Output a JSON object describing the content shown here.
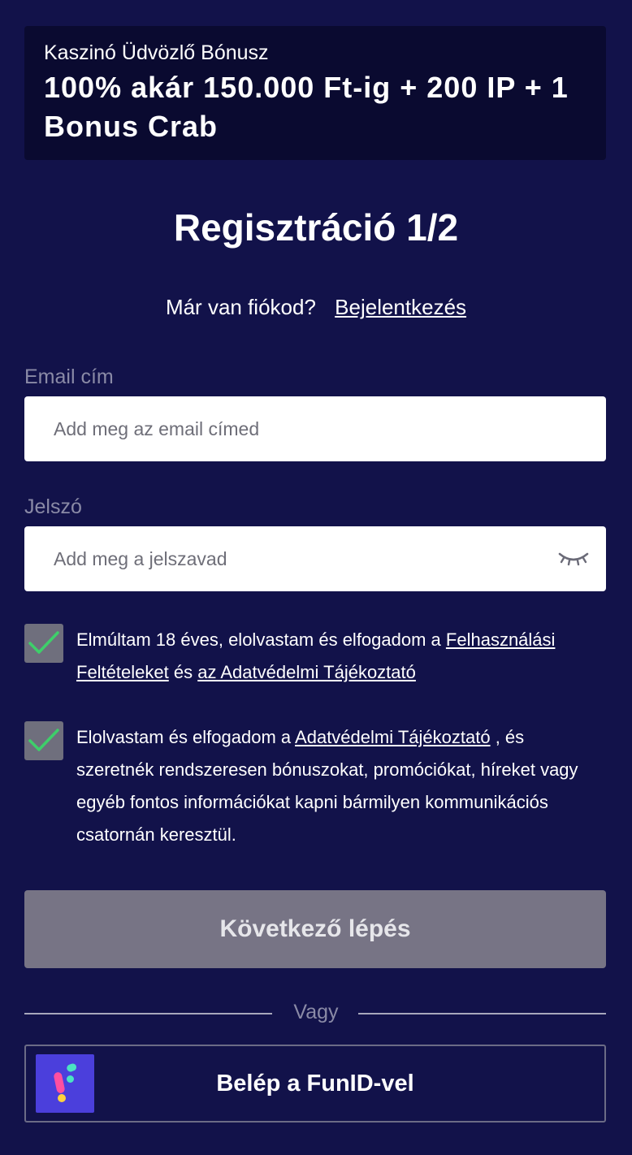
{
  "banner": {
    "subtitle": "Kaszinó Üdvözlő Bónusz",
    "title": "100% akár 150.000 Ft-ig + 200 IP + 1 Bonus Crab"
  },
  "page_title": "Regisztráció 1/2",
  "login_prompt": {
    "question": "Már van fiókod?",
    "link": "Bejelentkezés"
  },
  "email": {
    "label": "Email cím",
    "placeholder": "Add meg az email címed",
    "value": ""
  },
  "password": {
    "label": "Jelszó",
    "placeholder": "Add meg a jelszavad",
    "value": "",
    "toggle_icon": "eye-closed-icon"
  },
  "consent_terms": {
    "checked": true,
    "text_before": "Elmúltam 18 éves, elolvastam és elfogadom a",
    "link1": "Felhasználási Feltételeket",
    "text_middle": "és",
    "link2": "az Adatvédelmi Tájékoztató"
  },
  "consent_marketing": {
    "checked": true,
    "text_before": "Elolvastam és elfogadom a",
    "link": "Adatvédelmi Tájékoztató",
    "text_after": ", és szeretnék rendszeresen bónuszokat, promóciókat, híreket vagy egyéb fontos információkat kapni bármilyen kommunikációs csatornán keresztül."
  },
  "next_button": {
    "label": "Következő lépés",
    "enabled": false
  },
  "divider_text": "Vagy",
  "funid_button": {
    "label": "Belép a FunID-vel",
    "logo_icon": "funid-logo-icon"
  },
  "colors": {
    "background": "#12124a",
    "banner": "#0a0a30",
    "checkbox": "#6f6f7d",
    "check_mark": "#3ecf6a",
    "button_disabled": "#777485",
    "funid_logo_bg": "#4b3fdc"
  }
}
